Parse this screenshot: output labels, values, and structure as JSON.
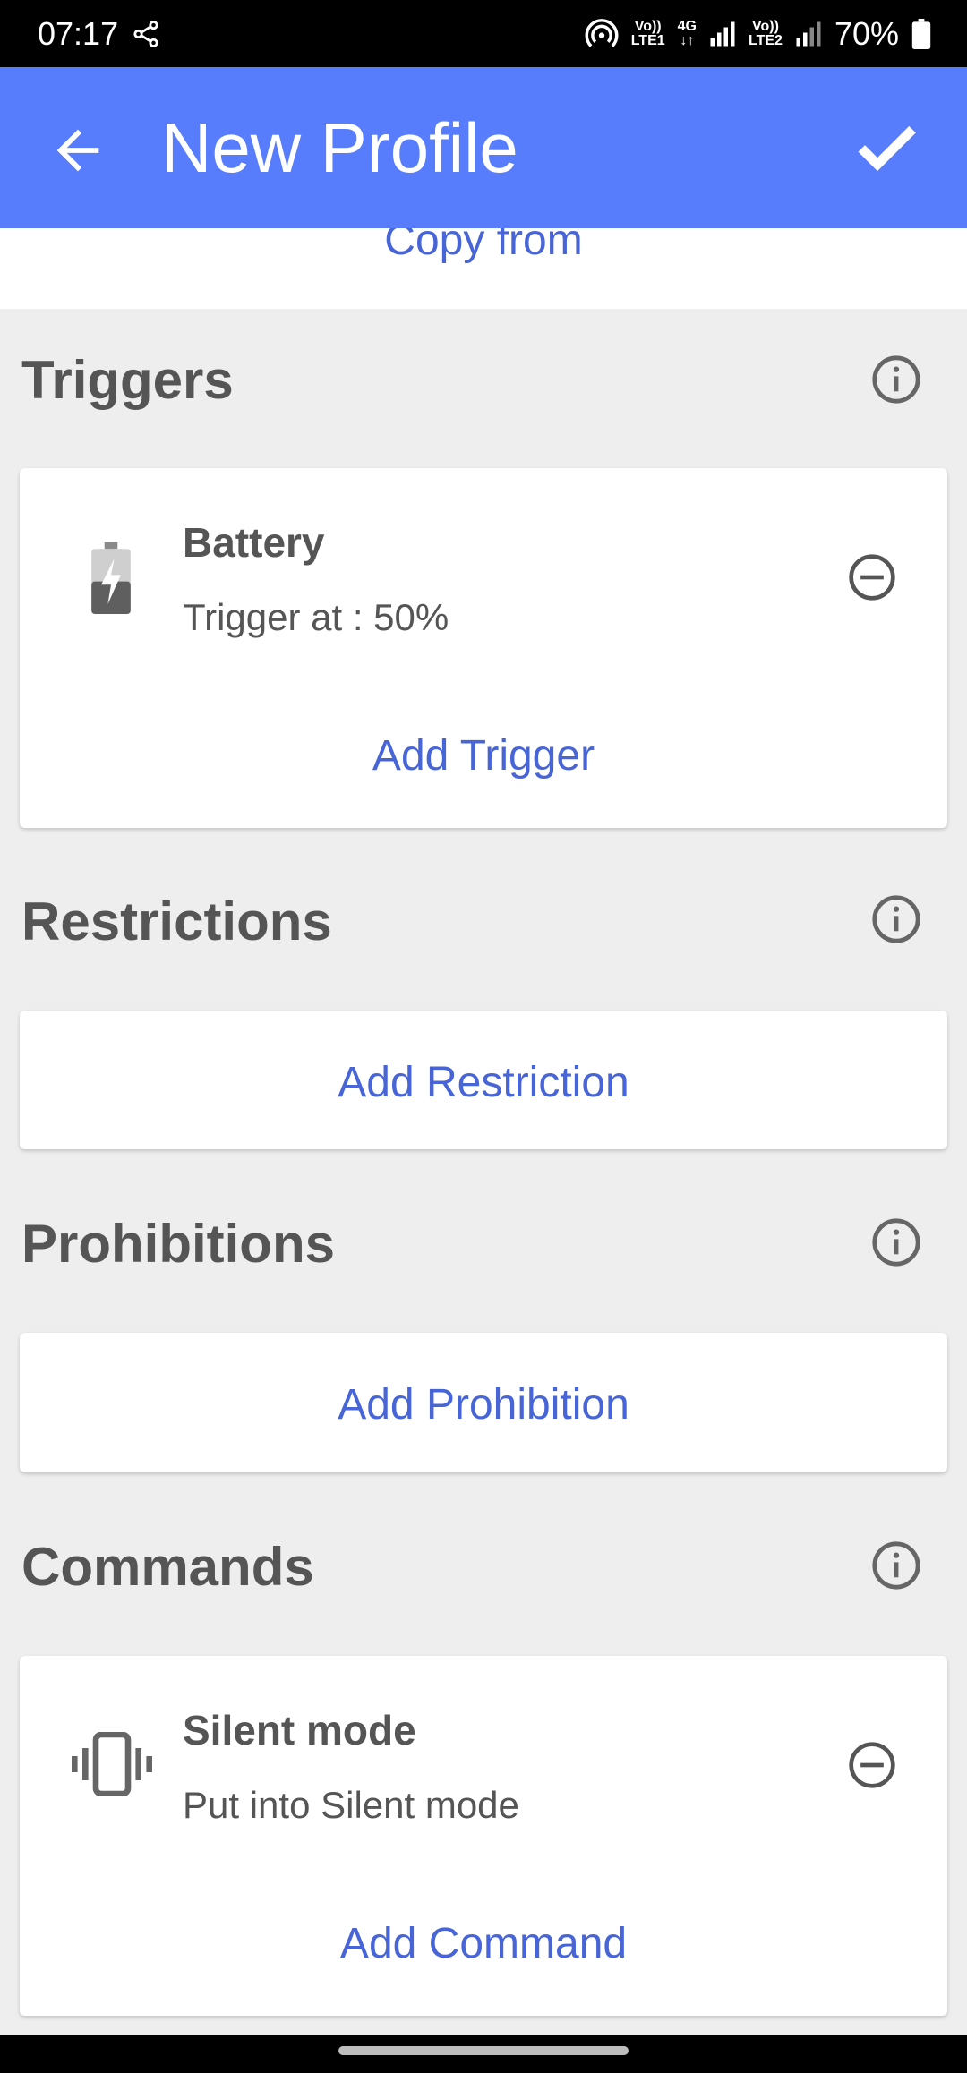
{
  "status_bar": {
    "time": "07:17",
    "battery": "70%",
    "sim1_label_top": "Vo))",
    "sim1_label_bottom": "LTE1",
    "network": "4G",
    "sim2_label_top": "Vo))",
    "sim2_label_bottom": "LTE2"
  },
  "app_bar": {
    "title": "New Profile"
  },
  "copy_from": "Copy from",
  "sections": {
    "triggers": {
      "title": "Triggers",
      "item": {
        "title": "Battery",
        "subtitle": "Trigger at : 50%"
      },
      "add_label": "Add Trigger"
    },
    "restrictions": {
      "title": "Restrictions",
      "add_label": "Add Restriction"
    },
    "prohibitions": {
      "title": "Prohibitions",
      "add_label": "Add Prohibition"
    },
    "commands": {
      "title": "Commands",
      "item": {
        "title": "Silent mode",
        "subtitle": "Put into Silent mode"
      },
      "add_label": "Add Command"
    }
  },
  "colors": {
    "app_bar": "#577dfc",
    "accent_text": "#4865d8",
    "background": "#eeeeee",
    "heading_text": "#555555"
  }
}
